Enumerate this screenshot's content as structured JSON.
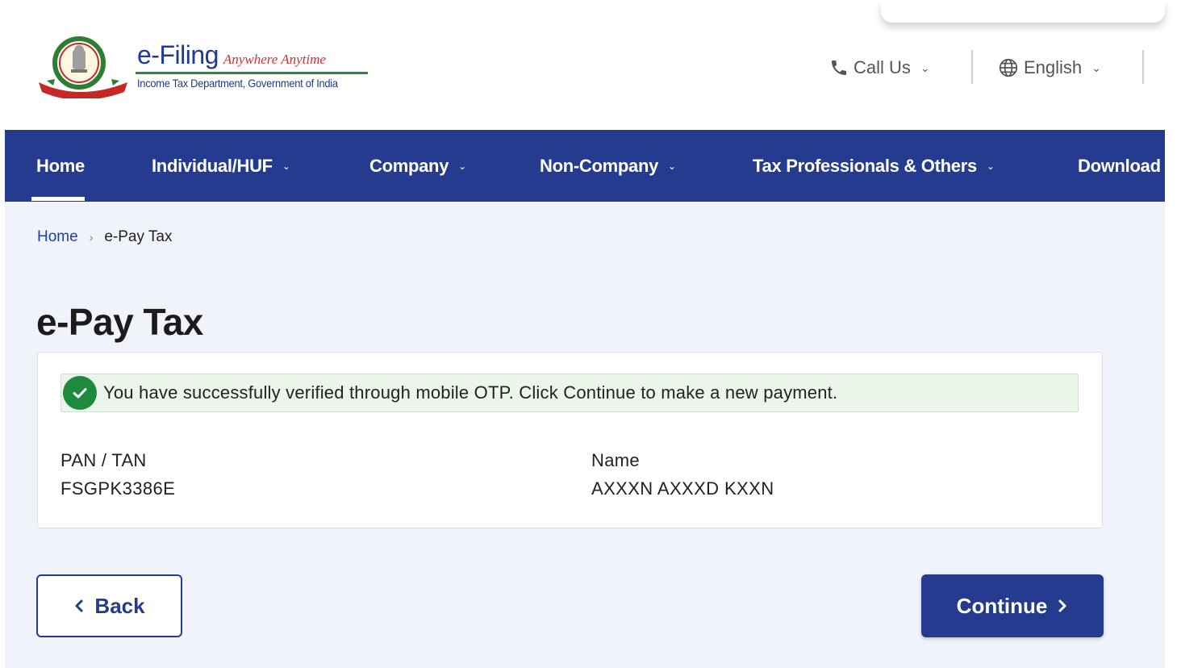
{
  "header": {
    "logo_title": "e-Filing",
    "logo_tagline": "Anywhere Anytime",
    "logo_department": "Income Tax Department, Government of India",
    "call_us": "Call Us",
    "language": "English"
  },
  "nav": {
    "items": [
      {
        "label": "Home",
        "has_dropdown": false,
        "active": true
      },
      {
        "label": "Individual/HUF",
        "has_dropdown": true
      },
      {
        "label": "Company",
        "has_dropdown": true
      },
      {
        "label": "Non-Company",
        "has_dropdown": true
      },
      {
        "label": "Tax Professionals & Others",
        "has_dropdown": true
      },
      {
        "label": "Download",
        "has_dropdown": false
      }
    ]
  },
  "breadcrumb": {
    "home": "Home",
    "current": "e-Pay Tax"
  },
  "page": {
    "title": "e-Pay Tax",
    "success_message": "You have successfully verified through mobile OTP. Click Continue to make a new payment.",
    "pan_label": "PAN / TAN",
    "pan_value": "FSGPK3386E",
    "name_label": "Name",
    "name_value": "AXXXN AXXXD KXXN"
  },
  "buttons": {
    "back": "Back",
    "continue": "Continue"
  },
  "colors": {
    "primary": "#243b8f",
    "success": "#1e8a3e",
    "success_bg": "#ecf5ea",
    "page_bg": "#f1f3fa"
  }
}
